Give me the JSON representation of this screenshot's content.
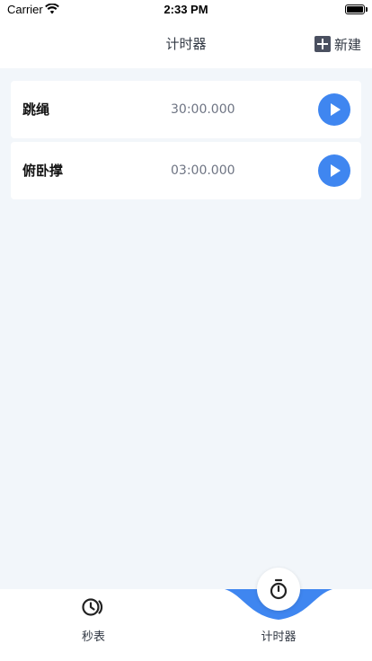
{
  "status_bar": {
    "carrier": "Carrier",
    "time": "2:33 PM"
  },
  "nav": {
    "title": "计时器",
    "new_label": "新建"
  },
  "timers": [
    {
      "name": "跳绳",
      "duration": "30:00.000"
    },
    {
      "name": "俯卧撑",
      "duration": "03:00.000"
    }
  ],
  "tabs": [
    {
      "label": "秒表",
      "icon": "stopwatch-icon",
      "selected": false
    },
    {
      "label": "计时器",
      "icon": "timer-icon",
      "selected": true
    }
  ],
  "colors": {
    "accent": "#3f86f0",
    "page_background": "#f2f6fa",
    "card_background": "#ffffff",
    "secondary_text": "#6e7483"
  }
}
